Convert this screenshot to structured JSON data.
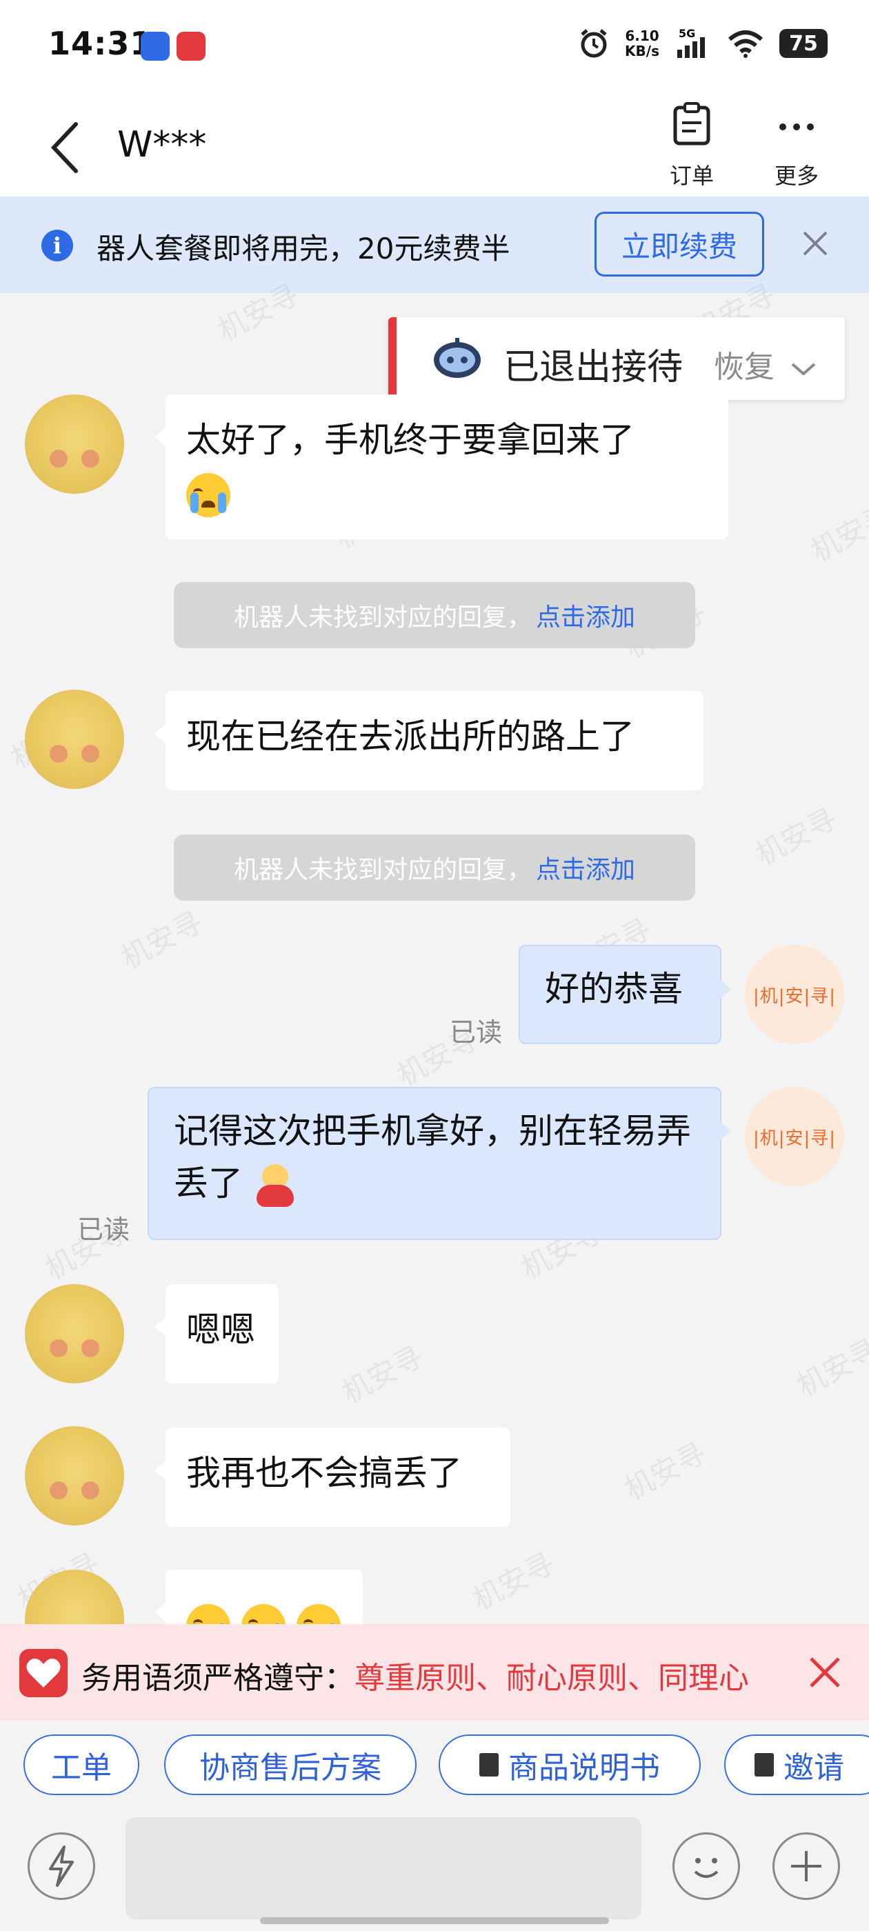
{
  "status_bar": {
    "time": "14:31",
    "net_speed_value": "6.10",
    "net_speed_unit": "KB/s",
    "signal_label": "5G",
    "battery": "75"
  },
  "header": {
    "title": "W***",
    "order_label": "订单",
    "more_label": "更多"
  },
  "notice": {
    "text": "器人套餐即将用完，20元续费半",
    "button_label": "立即续费"
  },
  "exit_card": {
    "text": "已退出接待",
    "restore_label": "恢复"
  },
  "messages": {
    "m1_text": "太好了，手机终于要拿回来了",
    "sys1_text": "机器人未找到对应的回复，",
    "sys1_link": "点击添加",
    "m2_text": "现在已经在去派出所的路上了",
    "sys2_text": "机器人未找到对应的回复，",
    "sys2_link": "点击添加",
    "out1_text": "好的恭喜",
    "out1_read": "已读",
    "out2_text": "记得这次把手机拿好，别在轻易弄丢了",
    "out2_read": "已读",
    "m3_text": "嗯嗯",
    "m4_text": "我再也不会搞丢了",
    "my_avatar_text": "|机|安|寻|"
  },
  "watermark": "机安寻",
  "rules": {
    "prefix": "务用语须严格遵守：",
    "highlight": "尊重原则、耐心原则、同理心"
  },
  "chips": [
    "工单",
    "协商售后方案",
    "商品说明书",
    "邀请"
  ]
}
